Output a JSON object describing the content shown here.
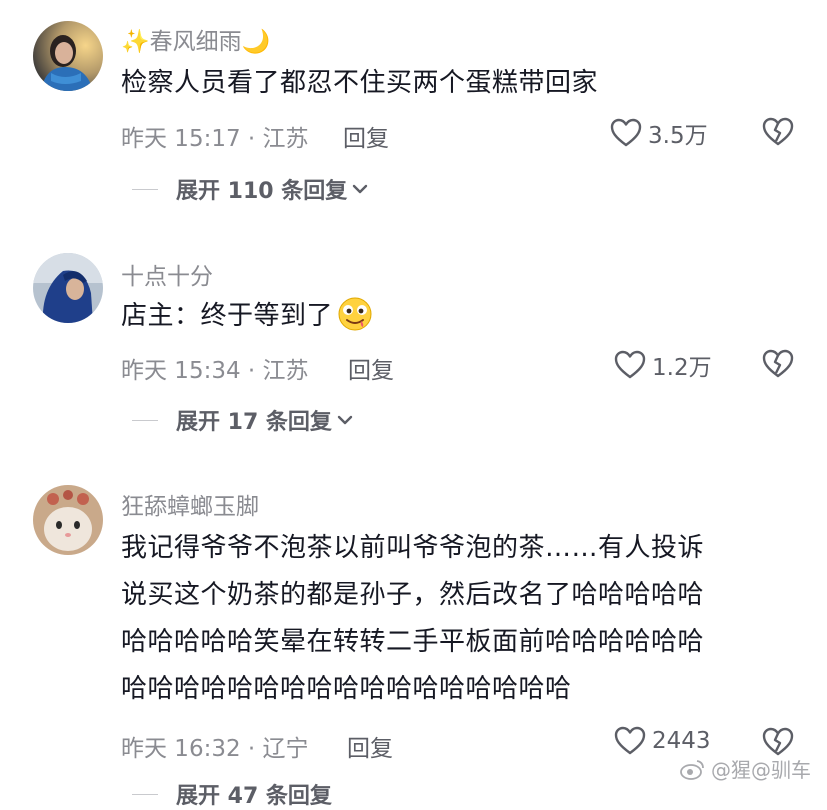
{
  "comments": [
    {
      "username": "✨春风细雨🌙",
      "text": "检察人员看了都忍不住买两个蛋糕带回家",
      "time_location": "昨天 15:17 · 江苏",
      "reply_label": "回复",
      "likes": "3.5万",
      "expand_label": "展开 110 条回复"
    },
    {
      "username": "十点十分",
      "text": "店主：终于等到了",
      "emoji": "drooling-face-icon",
      "time_location": "昨天 15:34 · 江苏",
      "reply_label": "回复",
      "likes": "1.2万",
      "expand_label": "展开 17 条回复"
    },
    {
      "username": "狂舔蟑螂玉脚",
      "text_lines": [
        "我记得爷爷不泡茶以前叫爷爷泡的茶……有人投诉",
        "说买这个奶茶的都是孙子，然后改名了哈哈哈哈哈",
        "哈哈哈哈哈笑晕在转转二手平板面前哈哈哈哈哈哈",
        "哈哈哈哈哈哈哈哈哈哈哈哈哈哈哈哈哈"
      ],
      "time_location": "昨天 16:32 · 辽宁",
      "reply_label": "回复",
      "likes": "2443",
      "expand_label": "展开 47 条回复"
    }
  ],
  "watermark": "@猩@驯车",
  "colors": {
    "text": "#161823",
    "secondary": "#8a8b91",
    "action": "#5c5e66"
  }
}
